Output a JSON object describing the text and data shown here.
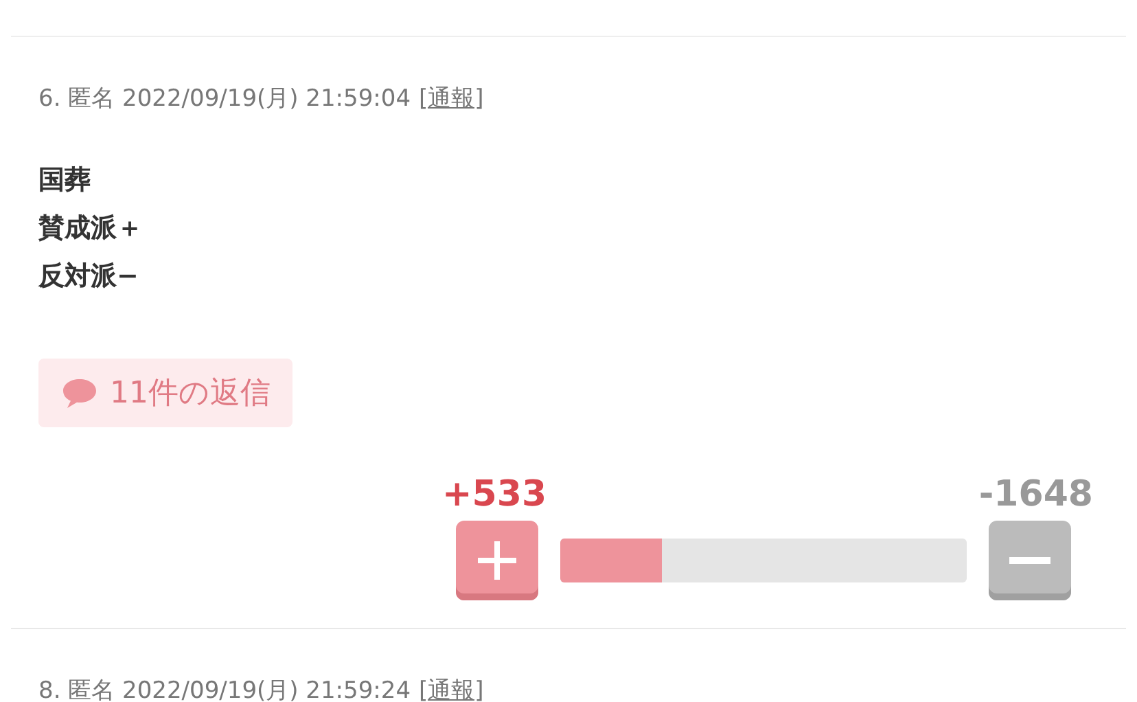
{
  "comments": [
    {
      "header": "6. 匿名 2022/09/19(月) 21:59:04",
      "report": "[通報]",
      "body": [
        "国葬",
        "賛成派＋",
        "反対派−"
      ],
      "replies": "11件の返信",
      "plus_score": "+533",
      "minus_score": "-1648",
      "vote": {
        "level": 0.25
      }
    },
    {
      "header": "8. 匿名 2022/09/19(月) 21:59:24",
      "report": "[通報]"
    }
  ]
}
